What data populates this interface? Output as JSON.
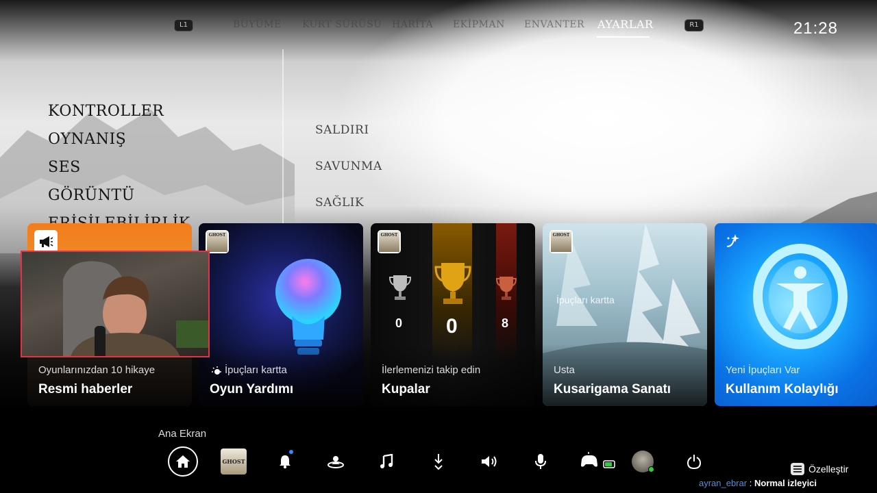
{
  "game": {
    "bumper_left": "L1",
    "bumper_right": "R1",
    "tabs": [
      {
        "label": "BÜYÜME"
      },
      {
        "label": "KURT SÜRÜSÜ"
      },
      {
        "label": "HARİTA"
      },
      {
        "label": "EKİPMAN"
      },
      {
        "label": "ENVANTER"
      },
      {
        "label": "AYARLAR",
        "active": true
      }
    ],
    "settings_menu": [
      "KONTROLLER",
      "OYNANIŞ",
      "SES",
      "GÖRÜNTÜ",
      "ERİŞİLEBİLİRLİK"
    ],
    "submenu": [
      "SALDIRI",
      "SAVUNMA",
      "SAĞLIK"
    ]
  },
  "system": {
    "clock": "21:28"
  },
  "cards": [
    {
      "subtitle": "Oyunlarınızdan 10 hikaye",
      "title": "Resmi haberler",
      "badge_icon": "megaphone-icon"
    },
    {
      "subtitle": "İpuçları kartta",
      "title": "Oyun Yardımı",
      "badge_icon": "game-cover-icon",
      "subtitle_icon": "hint-icon"
    },
    {
      "subtitle": "İlerlemenizi takip edin",
      "title": "Kupalar",
      "badge_icon": "game-cover-icon",
      "trophies": {
        "silver": "0",
        "gold": "0",
        "bronze": "8"
      }
    },
    {
      "subtitle": "Usta",
      "title": "Kusarigama Sanatı",
      "badge_icon": "game-cover-icon",
      "overlay_hint": "İpuçları kartta"
    },
    {
      "subtitle": "Yeni İpuçları Var",
      "title": "Kullanım Kolaylığı",
      "badge_icon": "sparkle-icon"
    }
  ],
  "badge_cover_text": "GHOST",
  "dock": {
    "home_label": "Ana Ekran",
    "game_cover_text": "GHOST",
    "items": [
      "home-icon",
      "game-library-icon",
      "notifications-icon",
      "game-base-icon",
      "music-icon",
      "downloads-icon",
      "sound-icon",
      "mic-icon",
      "controller-battery-icon",
      "profile-icon",
      "power-icon"
    ],
    "customize_label": "Özelleştir"
  },
  "chat": {
    "user": "ayran_ebrar",
    "separator": ":",
    "rank": "Normal izleyici"
  },
  "colors": {
    "news_card": "#f47d1e",
    "access_card": "#0a72e6",
    "webcam_border": "#e4343f",
    "chat_user": "#4f8fe6"
  }
}
